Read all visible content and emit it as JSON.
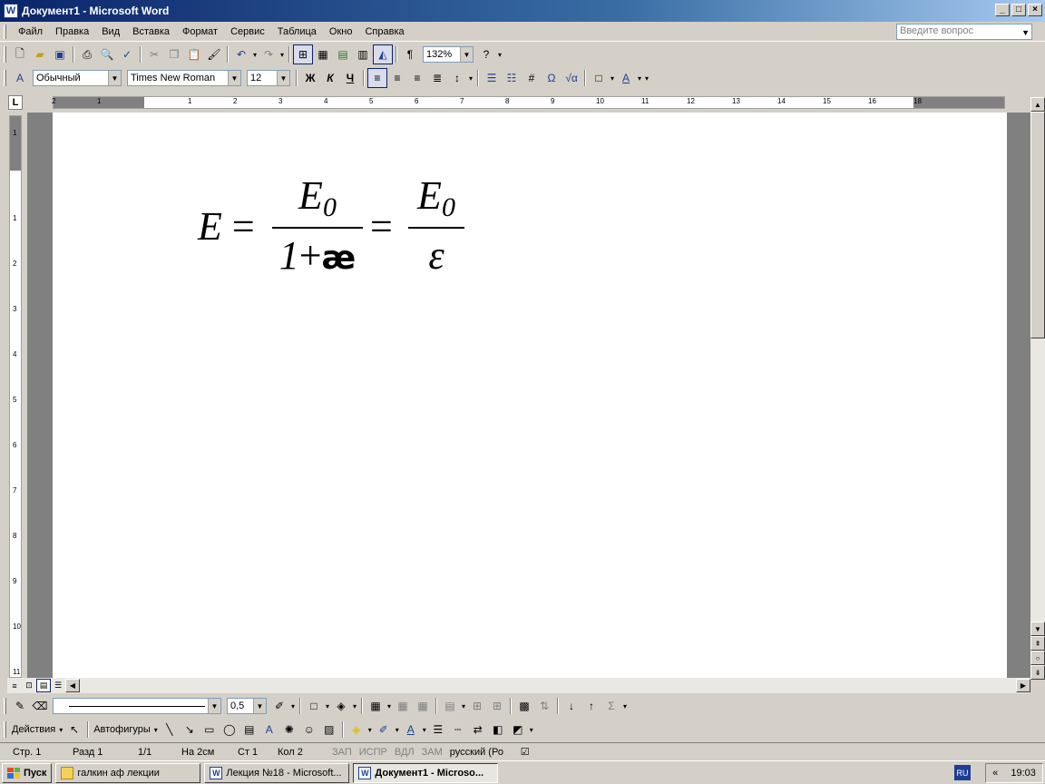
{
  "window": {
    "title": "Документ1 - Microsoft Word",
    "app_icon": "word-icon",
    "controls": [
      "_",
      "□",
      "×"
    ]
  },
  "menu": {
    "items": [
      "Файл",
      "Правка",
      "Вид",
      "Вставка",
      "Формат",
      "Сервис",
      "Таблица",
      "Окно",
      "Справка"
    ],
    "ask_placeholder": "Введите вопрос"
  },
  "standard_toolbar": {
    "zoom": "132%"
  },
  "formatting_toolbar": {
    "style": "Обычный",
    "font": "Times New Roman",
    "size": "12",
    "bold": "Ж",
    "italic": "К",
    "underline": "Ч"
  },
  "ruler": {
    "h_labels": [
      "2",
      "1",
      "1",
      "2",
      "3",
      "4",
      "5",
      "6",
      "7",
      "8",
      "9",
      "10",
      "11",
      "12",
      "13",
      "14",
      "15",
      "16",
      "18"
    ],
    "v_labels": [
      "1",
      "1",
      "2",
      "3",
      "4",
      "5",
      "6",
      "7",
      "8",
      "9",
      "10",
      "11"
    ],
    "corner": "L"
  },
  "document": {
    "formula": {
      "lhs_var": "E",
      "eq": "=",
      "frac1_num": "E",
      "frac1_num_sub": "0",
      "frac1_den_one": "1",
      "frac1_den_plus": "+",
      "frac1_den_ae": "æ",
      "frac2_num": "E",
      "frac2_num_sub": "0",
      "frac2_den": "ε"
    }
  },
  "drawing_toolbar": {
    "line_width": "0,5",
    "actions": "Действия",
    "autoshapes": "Автофигуры"
  },
  "status": {
    "page": "Стр. 1",
    "section": "Разд 1",
    "pages": "1/1",
    "at": "На 2см",
    "line": "Ст 1",
    "col": "Кол 2",
    "rec": "ЗАП",
    "trk": "ИСПР",
    "ext": "ВДЛ",
    "ovr": "ЗАМ",
    "lang": "русский (Ро"
  },
  "taskbar": {
    "start": "Пуск",
    "tasks": [
      {
        "label": "галкин аф лекции",
        "icon": "folder-icon",
        "active": false
      },
      {
        "label": "Лекция №18 - Microsoft...",
        "icon": "word-icon",
        "active": false
      },
      {
        "label": "Документ1 - Microso...",
        "icon": "word-icon",
        "active": true
      }
    ],
    "lang": "RU",
    "chevron": "«",
    "time": "19:03"
  }
}
